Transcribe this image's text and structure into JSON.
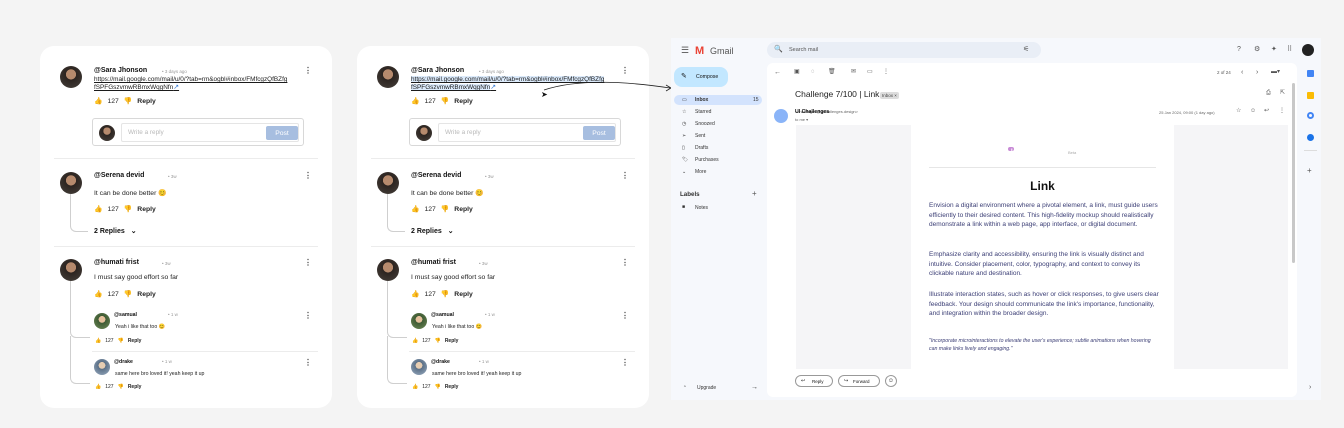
{
  "comments": {
    "c1": {
      "user": "@Sara Jhonson",
      "time": "3 days ago",
      "link": "https://mail.google.com/mail/u/0/?tab=rm&ogbl#inbox/FMfcgzQfBZfgfSPFGszvmwRBmxWqgNfn",
      "likes": "127",
      "reply": "Reply"
    },
    "reply_placeholder": "Write a reply",
    "post_label": "Post",
    "c2": {
      "user": "@Serena devid",
      "time": "3w",
      "text": "It can be done better 😊",
      "likes": "127",
      "reply": "Reply",
      "replies_label": "2 Replies"
    },
    "c3": {
      "user": "@humati frist",
      "time": "3w",
      "text": "I must say good effort so far",
      "likes": "127",
      "reply": "Reply"
    },
    "r1": {
      "user": "@samual",
      "time": "1 w",
      "text": "Yeah i like that too 😊",
      "likes": "127",
      "reply": "Reply"
    },
    "r2": {
      "user": "@drake",
      "time": "1 w",
      "text": "same here bro loved it! yeah keep it up",
      "likes": "127",
      "reply": "Reply"
    }
  },
  "gmail": {
    "brand": "Gmail",
    "search_placeholder": "Search mail",
    "compose": "Compose",
    "nav": [
      {
        "label": "Inbox",
        "count": "15"
      },
      {
        "label": "Starred"
      },
      {
        "label": "Snoozed"
      },
      {
        "label": "Sent"
      },
      {
        "label": "Drafts"
      },
      {
        "label": "Purchases"
      },
      {
        "label": "More"
      }
    ],
    "labels_title": "Labels",
    "labels": [
      "Notes"
    ],
    "upgrade": "Upgrade",
    "pager": "2 of 24",
    "subject": "Challenge 7/100 | Link",
    "inbox_tag": "Inbox ×",
    "sender": "UI Challenges",
    "sender_email": "<challenges@uichallenges.design>",
    "to": "to me ▾",
    "date": "25 Jan 2024, 09:00 (1 day ago)",
    "badge": "UI CHALLENGE",
    "badge_sub": "Beta",
    "heading": "Link",
    "para1": "Envision a digital environment where a pivotal element, a link, must guide users efficiently to their desired content. This high-fidelity mockup should realistically demonstrate a link within a web page, app interface, or digital document.",
    "para2": "Emphasize clarity and accessibility, ensuring the link is visually distinct and intuitive. Consider placement, color, typography, and context to convey its clickable nature and destination.",
    "para3": "Illustrate interaction states, such as hover or click responses, to give users clear feedback. Your design should communicate the link's importance, functionality, and integration within the broader design.",
    "quote": "\"Incorporate microinteractions to elevate the user's experience; subtle animations when hovering can make links lively and engaging.\"",
    "reply_btn": "Reply",
    "forward_btn": "Forward"
  },
  "colors": {
    "accent": "#a7bee0",
    "badge": "#c88ad6",
    "compose": "#c2e7ff",
    "selected": "#d3e3fd"
  }
}
